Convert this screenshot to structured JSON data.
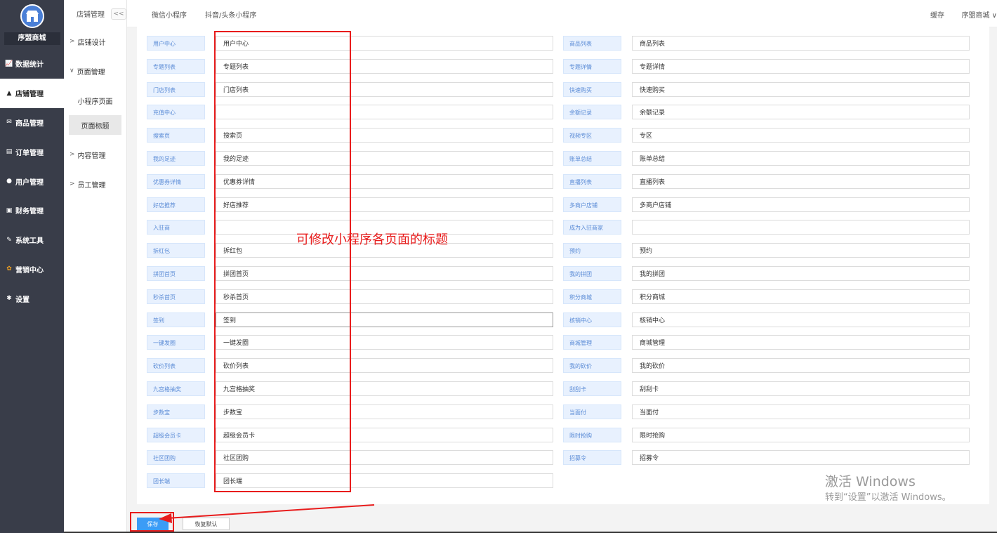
{
  "sidebar": {
    "brand": "序盟商城",
    "items": [
      {
        "label": "数据统计",
        "icon": "chart-icon"
      },
      {
        "label": "店铺管理",
        "icon": "store-icon",
        "active": true
      },
      {
        "label": "商品管理",
        "icon": "mail-icon"
      },
      {
        "label": "订单管理",
        "icon": "list-icon"
      },
      {
        "label": "用户管理",
        "icon": "user-icon"
      },
      {
        "label": "财务管理",
        "icon": "wallet-icon"
      },
      {
        "label": "系统工具",
        "icon": "wrench-icon"
      },
      {
        "label": "营销中心",
        "icon": "palette-icon"
      },
      {
        "label": "设置",
        "icon": "gear-icon"
      }
    ]
  },
  "submenu": {
    "title": "店铺管理",
    "collapse": "<<",
    "groups": [
      {
        "label": "店铺设计"
      },
      {
        "label": "页面管理"
      },
      {
        "label": "内容管理"
      },
      {
        "label": "员工管理"
      }
    ],
    "items": [
      {
        "label": "小程序页面"
      },
      {
        "label": "页面标题",
        "active": true
      }
    ]
  },
  "topbar": {
    "tabs": [
      "微信小程序",
      "抖音/头条小程序"
    ],
    "cache": "缓存",
    "user": "序盟商城"
  },
  "fields": {
    "left": [
      {
        "label": "用户中心",
        "value": "用户中心"
      },
      {
        "label": "专题列表",
        "value": "专题列表"
      },
      {
        "label": "门店列表",
        "value": "门店列表"
      },
      {
        "label": "充值中心",
        "value": ""
      },
      {
        "label": "搜索页",
        "value": "搜索页"
      },
      {
        "label": "我的足迹",
        "value": "我的足迹"
      },
      {
        "label": "优惠券详情",
        "value": "优惠券详情"
      },
      {
        "label": "好店推荐",
        "value": "好店推荐"
      },
      {
        "label": "入驻商",
        "value": ""
      },
      {
        "label": "拆红包",
        "value": "拆红包"
      },
      {
        "label": "拼团首页",
        "value": "拼团首页"
      },
      {
        "label": "秒杀首页",
        "value": "秒杀首页"
      },
      {
        "label": "签到",
        "value": "签到"
      },
      {
        "label": "一键发圈",
        "value": "一键发圈"
      },
      {
        "label": "砍价列表",
        "value": "砍价列表"
      },
      {
        "label": "九宫格抽奖",
        "value": "九宫格抽奖"
      },
      {
        "label": "步数宝",
        "value": "步数宝"
      },
      {
        "label": "超级会员卡",
        "value": "超级会员卡"
      },
      {
        "label": "社区团购",
        "value": "社区团购"
      },
      {
        "label": "团长端",
        "value": "团长端"
      }
    ],
    "right": [
      {
        "label": "商品列表",
        "value": "商品列表"
      },
      {
        "label": "专题详情",
        "value": "专题详情"
      },
      {
        "label": "快速购买",
        "value": "快速购买"
      },
      {
        "label": "余额记录",
        "value": "余额记录"
      },
      {
        "label": "视频专区",
        "value": "专区"
      },
      {
        "label": "账单总结",
        "value": "账单总结"
      },
      {
        "label": "直播列表",
        "value": "直播列表"
      },
      {
        "label": "多商户店铺",
        "value": "多商户店铺"
      },
      {
        "label": "成为入驻商家",
        "value": ""
      },
      {
        "label": "预约",
        "value": "预约"
      },
      {
        "label": "我的拼团",
        "value": "我的拼团"
      },
      {
        "label": "积分商城",
        "value": "积分商城"
      },
      {
        "label": "核销中心",
        "value": "核销中心"
      },
      {
        "label": "商城管理",
        "value": "商城管理"
      },
      {
        "label": "我的砍价",
        "value": "我的砍价"
      },
      {
        "label": "刮刮卡",
        "value": "刮刮卡"
      },
      {
        "label": "当面付",
        "value": "当面付"
      },
      {
        "label": "限时抢购",
        "value": "限时抢购"
      },
      {
        "label": "招募令",
        "value": "招募令"
      }
    ]
  },
  "annotation": {
    "text": "可修改小程序各页面的标题"
  },
  "actions": {
    "save": "保存",
    "reset": "恢复默认"
  },
  "watermark": {
    "line1": "激活 Windows",
    "line2": "转到“设置”以激活 Windows。"
  },
  "colors": {
    "sidebar_bg": "#393d49",
    "label_bg": "#e8f1fe",
    "label_text": "#5a8bd6",
    "save_btn": "#3b9cf6",
    "annotation": "#e81c1c"
  }
}
